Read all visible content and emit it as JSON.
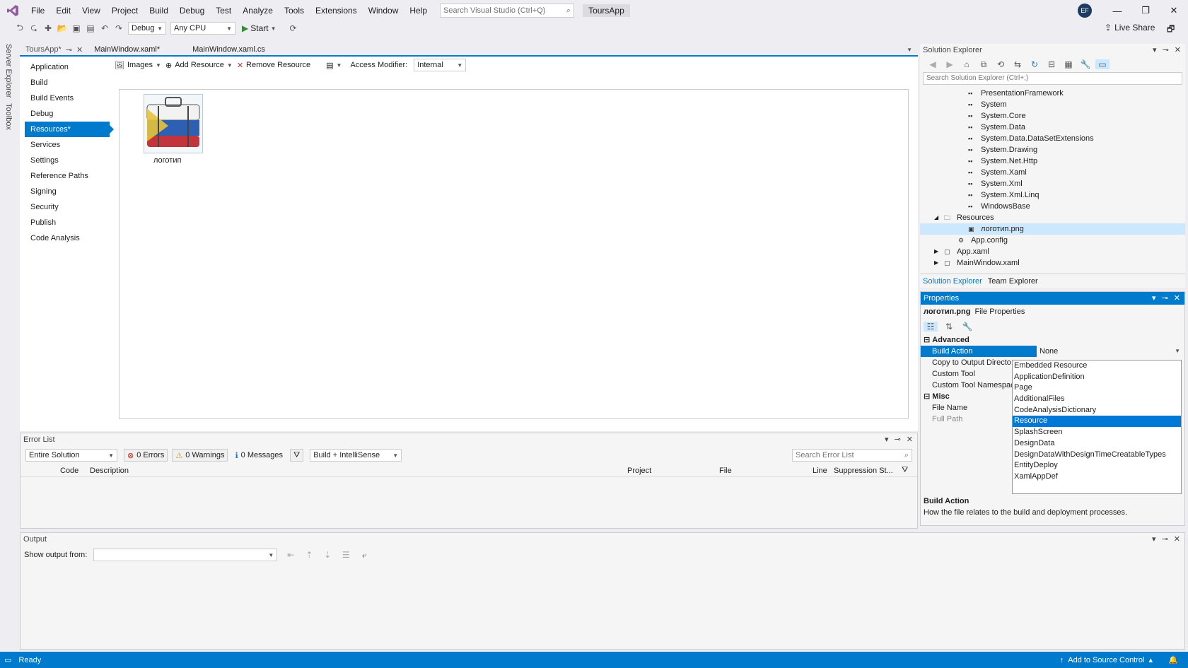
{
  "menu": {
    "items": [
      "File",
      "Edit",
      "View",
      "Project",
      "Build",
      "Debug",
      "Test",
      "Analyze",
      "Tools",
      "Extensions",
      "Window",
      "Help"
    ],
    "search_placeholder": "Search Visual Studio (Ctrl+Q)",
    "app_name": "ToursApp",
    "avatar_initials": "EF"
  },
  "toolbar": {
    "config": "Debug",
    "platform": "Any CPU",
    "start_label": "Start",
    "live_share": "Live Share"
  },
  "vertical_tabs": [
    "Server Explorer",
    "Toolbox"
  ],
  "doc_tabs": [
    {
      "label": "ToursApp*",
      "active": true
    },
    {
      "label": "MainWindow.xaml*",
      "active": false
    },
    {
      "label": "MainWindow.xaml.cs",
      "active": false
    }
  ],
  "project_nav": {
    "items": [
      "Application",
      "Build",
      "Build Events",
      "Debug",
      "Resources*",
      "Services",
      "Settings",
      "Reference Paths",
      "Signing",
      "Security",
      "Publish",
      "Code Analysis"
    ],
    "selected": "Resources*"
  },
  "resources": {
    "images_label": "Images",
    "add_label": "Add Resource",
    "remove_label": "Remove Resource",
    "access_label": "Access Modifier:",
    "access_value": "Internal",
    "item_label": "логотип"
  },
  "error_list": {
    "title": "Error List",
    "scope": "Entire Solution",
    "errors": "0 Errors",
    "warnings": "0 Warnings",
    "messages": "0 Messages",
    "build_filter": "Build + IntelliSense",
    "search_placeholder": "Search Error List",
    "columns": [
      "Code",
      "Description",
      "Project",
      "File",
      "Line",
      "Suppression St..."
    ]
  },
  "output": {
    "title": "Output",
    "show_from_label": "Show output from:"
  },
  "solution_explorer": {
    "title": "Solution Explorer",
    "search_placeholder": "Search Solution Explorer (Ctrl+;)",
    "references": [
      "PresentationFramework",
      "System",
      "System.Core",
      "System.Data",
      "System.Data.DataSetExtensions",
      "System.Drawing",
      "System.Net.Http",
      "System.Xaml",
      "System.Xml",
      "System.Xml.Linq",
      "WindowsBase"
    ],
    "resources_folder": "Resources",
    "resource_file": "логотип.png",
    "files": [
      "App.config",
      "App.xaml",
      "MainWindow.xaml"
    ],
    "tabs": [
      "Solution Explorer",
      "Team Explorer"
    ]
  },
  "properties": {
    "title": "Properties",
    "object_name": "логотип.png",
    "object_type": "File Properties",
    "category_advanced": "Advanced",
    "category_misc": "Misc",
    "rows": [
      {
        "name": "Build Action",
        "value": "None"
      },
      {
        "name": "Copy to Output Directo",
        "value": ""
      },
      {
        "name": "Custom Tool",
        "value": ""
      },
      {
        "name": "Custom Tool Namespac",
        "value": ""
      }
    ],
    "misc_rows": [
      "File Name",
      "Full Path"
    ],
    "dropdown_options": [
      "Embedded Resource",
      "ApplicationDefinition",
      "Page",
      "AdditionalFiles",
      "CodeAnalysisDictionary",
      "Resource",
      "SplashScreen",
      "DesignData",
      "DesignDataWithDesignTimeCreatableTypes",
      "EntityDeploy",
      "XamlAppDef"
    ],
    "dropdown_selected": "Resource",
    "description_title": "Build Action",
    "description_text": "How the file relates to the build and deployment processes."
  },
  "status": {
    "text": "Ready",
    "source_control": "Add to Source Control"
  },
  "colors": {
    "accent": "#007acc",
    "background": "#eeeef2"
  }
}
